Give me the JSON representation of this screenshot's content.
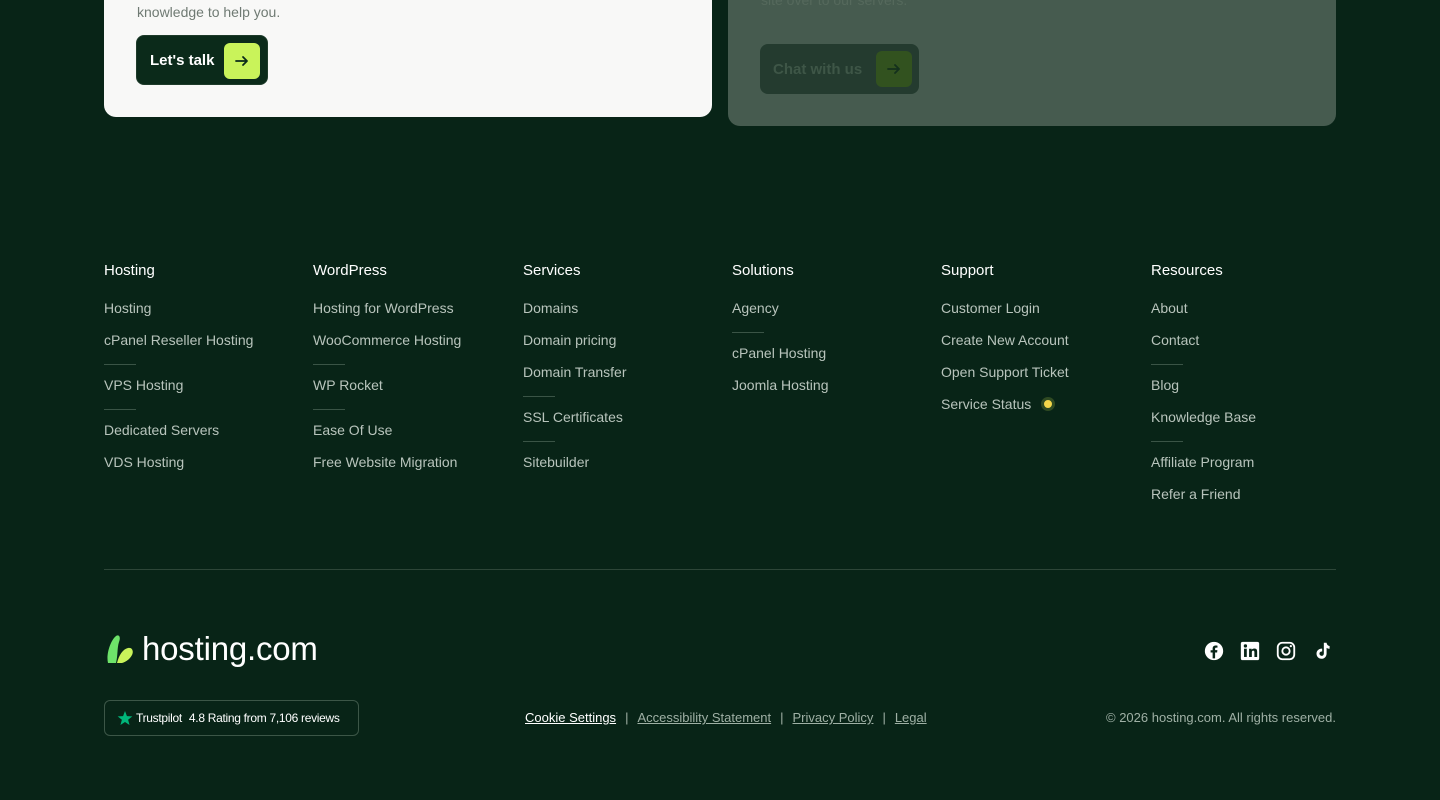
{
  "cards": {
    "left": {
      "desc": "knowledge to help you.",
      "button": "Let's talk"
    },
    "right": {
      "desc": "site over to our servers.",
      "button": "Chat with us"
    }
  },
  "footer": {
    "columns": [
      {
        "title": "Hosting",
        "items": [
          "Hosting",
          "cPanel Reseller Hosting",
          "|",
          "VPS Hosting",
          "|",
          "Dedicated Servers",
          "VDS Hosting"
        ]
      },
      {
        "title": "WordPress",
        "items": [
          "Hosting for WordPress",
          "WooCommerce Hosting",
          "|",
          "WP Rocket",
          "|",
          "Ease Of Use",
          "Free Website Migration"
        ]
      },
      {
        "title": "Services",
        "items": [
          "Domains",
          "Domain pricing",
          "Domain Transfer",
          "|",
          "SSL Certificates",
          "|",
          "Sitebuilder"
        ]
      },
      {
        "title": "Solutions",
        "items": [
          "Agency",
          "|",
          "cPanel Hosting",
          "Joomla Hosting"
        ]
      },
      {
        "title": "Support",
        "items": [
          "Customer Login",
          "Create New Account",
          "Open Support Ticket",
          "Service Status"
        ]
      },
      {
        "title": "Resources",
        "items": [
          "About",
          "Contact",
          "|",
          "Blog",
          "Knowledge Base",
          "|",
          "Affiliate Program",
          "Refer a Friend"
        ]
      }
    ]
  },
  "brand": {
    "wordmark": "hosting.com"
  },
  "social": [
    "facebook-icon",
    "linkedin-icon",
    "instagram-icon",
    "tiktok-icon"
  ],
  "trustpilot": {
    "name": "Trustpilot",
    "rating_text": "4.8 Rating from 7,106 reviews"
  },
  "legal": {
    "cookie": "Cookie Settings",
    "accessibility": "Accessibility Statement",
    "privacy": "Privacy Policy",
    "legal": "Legal",
    "separator": "|"
  },
  "copyright": "© 2026 hosting.com. All rights reserved.",
  "colors": {
    "accent": "#c9f35a",
    "background": "#082417",
    "status": "#f4d64a"
  }
}
